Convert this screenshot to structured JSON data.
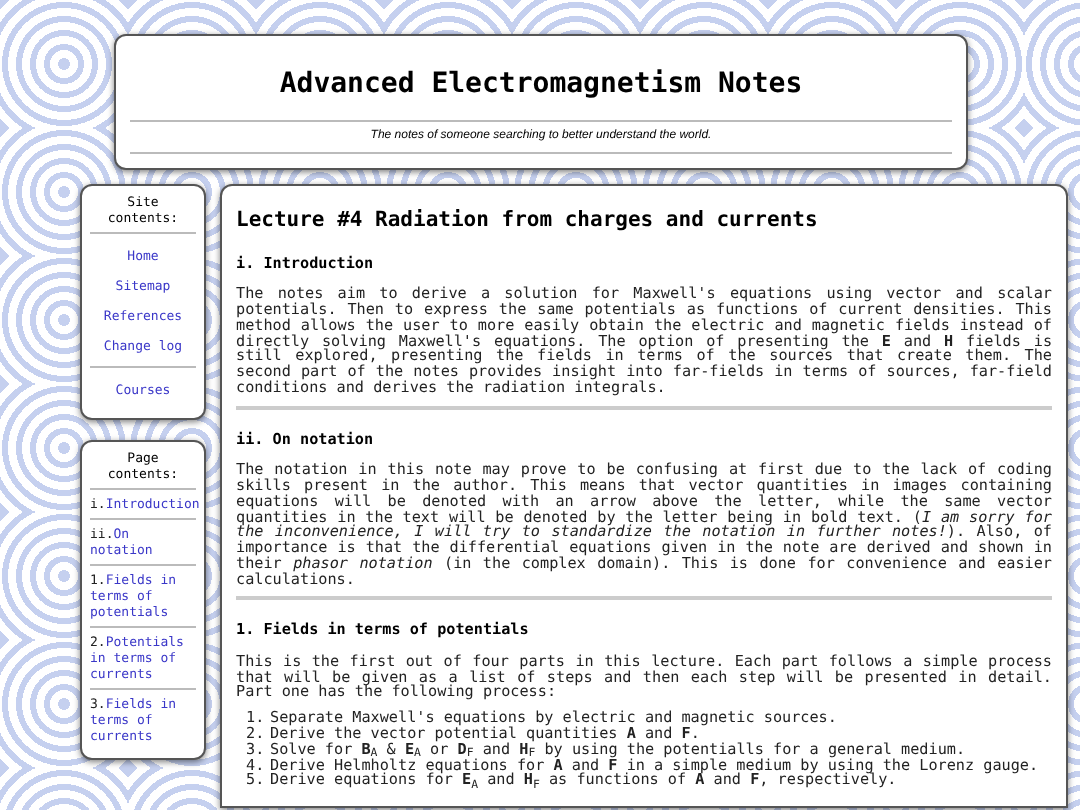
{
  "header": {
    "title": "Advanced Electromagnetism Notes",
    "tagline": "The notes of someone searching to better understand the world."
  },
  "site_contents": {
    "title": "Site contents:",
    "groups": [
      [
        "Home",
        "Sitemap",
        "References",
        "Change log"
      ],
      [
        "Courses"
      ]
    ]
  },
  "page_contents": {
    "title": "Page contents:",
    "items": [
      {
        "number": "i.",
        "label": "Introduction"
      },
      {
        "number": "ii.",
        "label": "On notation"
      },
      {
        "number": "1.",
        "label": "Fields in terms of potentials"
      },
      {
        "number": "2.",
        "label": "Potentials in terms of currents"
      },
      {
        "number": "3.",
        "label": "Fields in terms of currents"
      }
    ]
  },
  "article": {
    "title": "Lecture #4 Radiation from charges and currents",
    "sections": [
      {
        "heading": "i. Introduction",
        "paragraphs": [
          "The notes aim to derive a solution for Maxwell's equations using vector and scalar potentials. Then to express the same potentials as functions of current densities. This method allows the user to more easily obtain the electric and magnetic fields instead of directly solving Maxwell's equations. The option of presenting the **E** and **H** fields is still explored, presenting the fields in terms of the sources that create them. The second part of the notes provides insight into far-fields in terms of sources, far-field conditions and derives the radiation integrals."
        ]
      },
      {
        "heading": "ii. On notation",
        "paragraphs": [
          "The notation in this note may prove to be confusing at first due to the lack of coding skills present in the author. This means that vector quantities in images containing equations will be denoted with an arrow above the letter, while the same vector quantities in the text will be denoted by the letter being in bold text. (*I am sorry for the inconvenience, I will try to standardize the notation in further notes!*). Also, of importance is that the differential equations given in the note are derived and shown in their *phasor notation* (in the complex domain). This is done for convenience and easier calculations."
        ]
      },
      {
        "heading": "1. Fields in terms of potentials",
        "paragraphs": [
          "This is the first out of four parts in this lecture. Each part follows a simple process that will be given as a list of steps and then each step will be presented in detail. Part one has the following process:"
        ],
        "steps": [
          {
            "number": "1.",
            "text": "Separate Maxwell's equations by electric and magnetic sources."
          },
          {
            "number": "2.",
            "text": "Derive the vector potential quantities **A** and **F**."
          },
          {
            "number": "3.",
            "text": "Solve for **B**$_{A}$ & **E**$_{A}$ or **D**$_{F}$ and **H**$_{F}$ by using the potentialls for a general medium."
          },
          {
            "number": "4.",
            "text": "Derive Helmholtz equations for **A** and **F** in a simple medium by using the Lorenz gauge."
          },
          {
            "number": "5.",
            "text": "Derive equations for **E**$_{A}$ and **H**$_{F}$ as functions of **A** and **F**, respectively."
          }
        ]
      }
    ]
  }
}
